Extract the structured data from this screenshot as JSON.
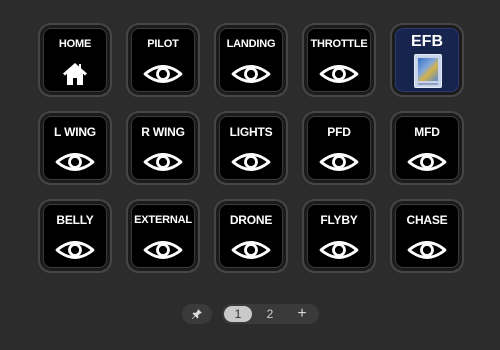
{
  "buttons": [
    {
      "label": "HOME",
      "icon": "home-icon"
    },
    {
      "label": "PILOT",
      "icon": "eye-icon"
    },
    {
      "label": "LANDING",
      "icon": "eye-icon"
    },
    {
      "label": "THROTTLE",
      "icon": "eye-icon"
    },
    {
      "label": "EFB",
      "icon": "tablet-icon"
    },
    {
      "label": "L WING",
      "icon": "eye-icon"
    },
    {
      "label": "R WING",
      "icon": "eye-icon"
    },
    {
      "label": "LIGHTS",
      "icon": "eye-icon"
    },
    {
      "label": "PFD",
      "icon": "eye-icon"
    },
    {
      "label": "MFD",
      "icon": "eye-icon"
    },
    {
      "label": "BELLY",
      "icon": "eye-icon"
    },
    {
      "label": "EXTERNAL",
      "icon": "eye-icon"
    },
    {
      "label": "DRONE",
      "icon": "eye-icon"
    },
    {
      "label": "FLYBY",
      "icon": "eye-icon"
    },
    {
      "label": "CHASE",
      "icon": "eye-icon"
    }
  ],
  "pager": {
    "pin_icon": "pin-icon",
    "pages": [
      "1",
      "2"
    ],
    "active_page": "1",
    "add_label": "+"
  },
  "colors": {
    "background": "#2c2c2c",
    "key_face": "#000000",
    "efb_face": "#16244e",
    "active_page": "#c9c9c9"
  }
}
